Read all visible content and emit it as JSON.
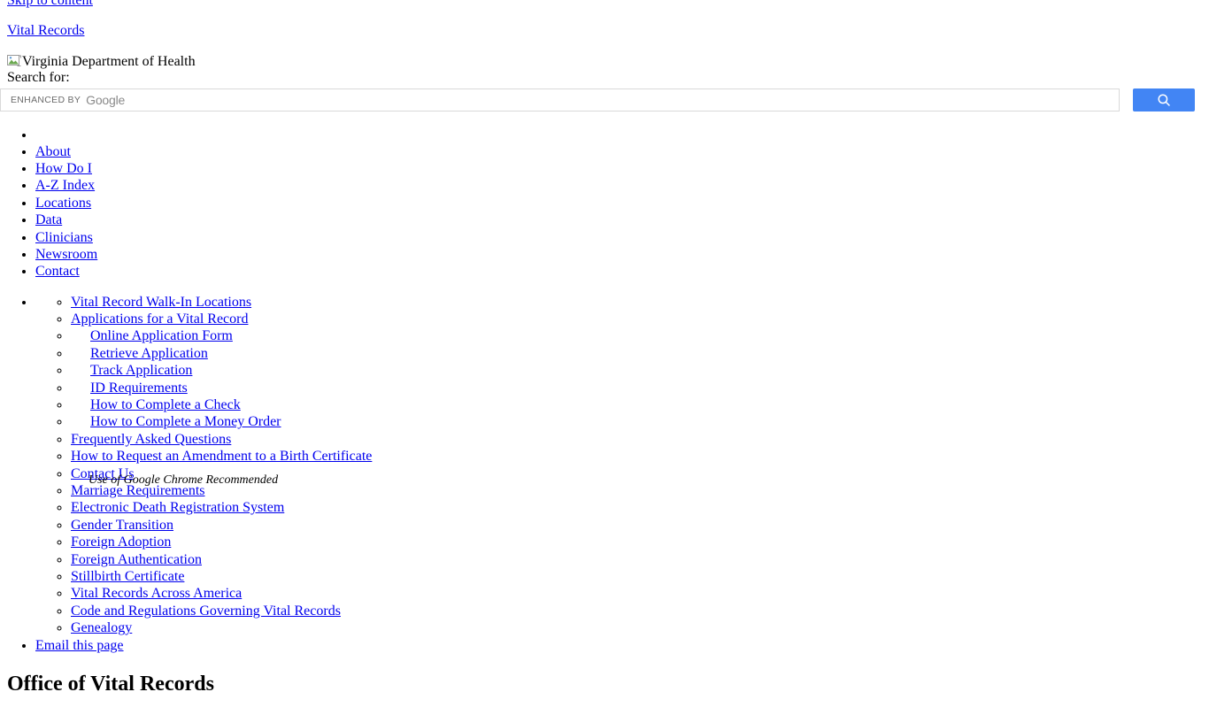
{
  "page": {
    "skip_link": "Skip to content",
    "site_link": "Vital Records",
    "logo_alt": "Virginia Department of Health",
    "heading": "Office of Vital Records",
    "chrome_note": "Use of Google Chrome Recommended",
    "link_color": "#0000EE",
    "button_color": "#4285f4"
  },
  "search": {
    "label": "Search for:",
    "value": "",
    "placeholder": "",
    "branding_enhanced": "ENHANCED BY",
    "branding_google": "Google",
    "button_icon": "search-icon"
  },
  "primary_nav": {
    "items": [
      {
        "label": ""
      },
      {
        "label": "About"
      },
      {
        "label": "How Do I"
      },
      {
        "label": "A-Z Index"
      },
      {
        "label": "Locations"
      },
      {
        "label": "Data"
      },
      {
        "label": "Clinicians"
      },
      {
        "label": "Newsroom"
      },
      {
        "label": "Contact"
      }
    ]
  },
  "section_nav": {
    "items": [
      {
        "label": "Vital Record Walk-In Locations",
        "indented": false
      },
      {
        "label": "Applications for a Vital Record",
        "indented": false
      },
      {
        "label": "Online Application Form",
        "indented": true
      },
      {
        "label": "Retrieve Application",
        "indented": true
      },
      {
        "label": "Track Application",
        "indented": true
      },
      {
        "label": "ID Requirements",
        "indented": true
      },
      {
        "label": "How to Complete a Check",
        "indented": true
      },
      {
        "label": "How to Complete a Money Order",
        "indented": true
      },
      {
        "label": "Frequently Asked Questions",
        "indented": false
      },
      {
        "label": "How to Request an Amendment to a Birth Certificate",
        "indented": false
      },
      {
        "label": "Contact Us",
        "indented": false
      },
      {
        "label": "Marriage Requirements",
        "indented": false
      },
      {
        "label": "Electronic Death Registration System",
        "indented": false
      },
      {
        "label": "Gender Transition",
        "indented": false
      },
      {
        "label": "Foreign Adoption",
        "indented": false
      },
      {
        "label": "Foreign Authentication",
        "indented": false
      },
      {
        "label": "Stillbirth Certificate",
        "indented": false
      },
      {
        "label": "Vital Records Across America",
        "indented": false
      },
      {
        "label": "Code and Regulations Governing Vital Records",
        "indented": false
      },
      {
        "label": "Genealogy",
        "indented": false
      }
    ],
    "email_this_page": "Email this page"
  }
}
